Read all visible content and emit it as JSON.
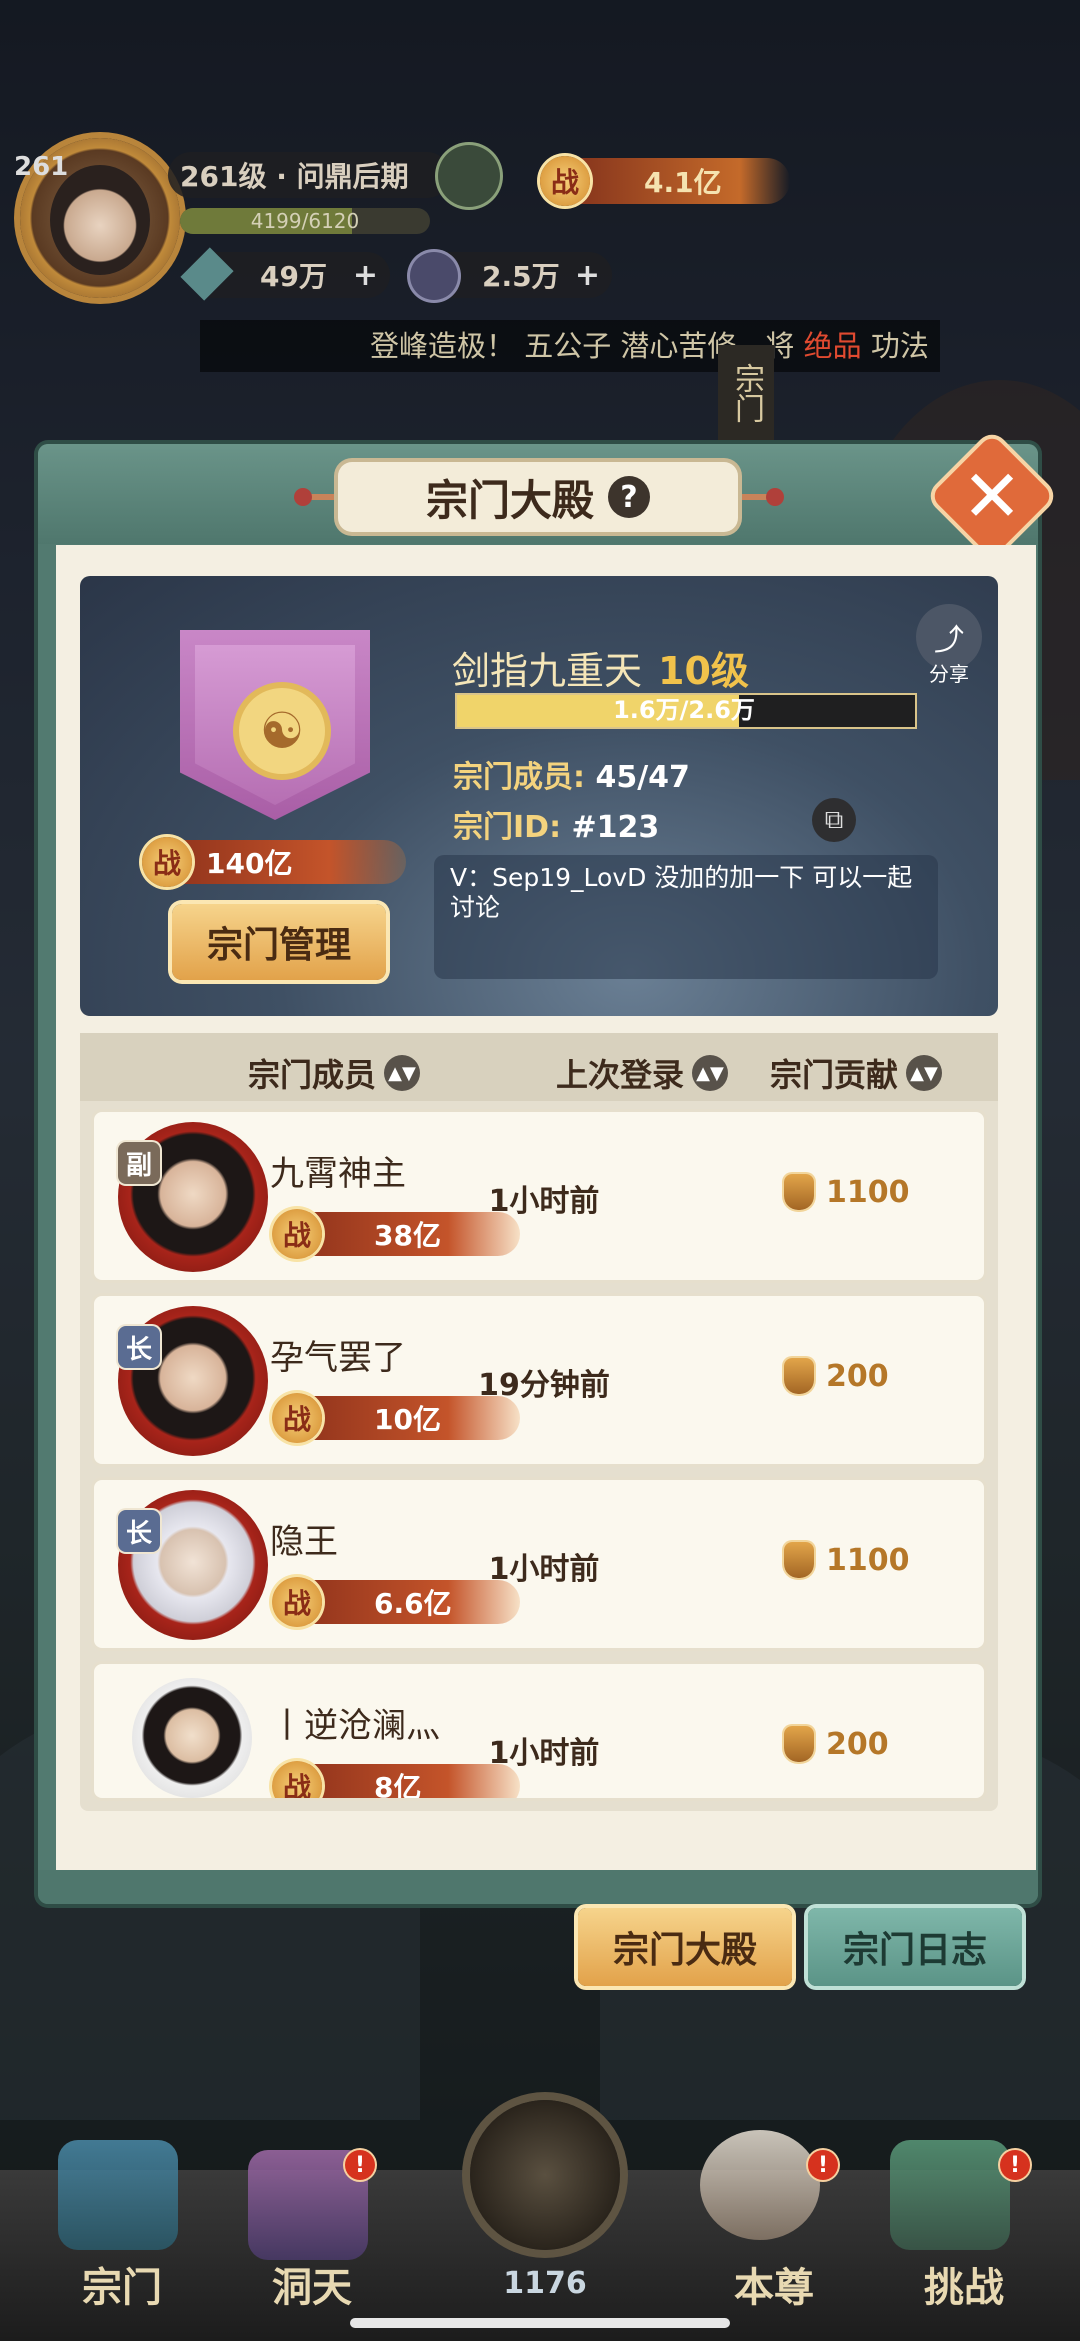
{
  "hud": {
    "player_level": "261",
    "realm": "261级 · 问鼎后期",
    "exp": "4199/6120",
    "exp_fraction": 0.686,
    "power": "4.1亿",
    "currency1": "49万",
    "currency2": "2.5万",
    "marquee_a": "登峰造极！ 五公子 潜心苦修，将 ",
    "marquee_b": "绝品",
    "marquee_c": " 功法",
    "side_sign": "宗门"
  },
  "panel": {
    "title": "宗门大殿",
    "help": "?",
    "close": "✕"
  },
  "sect": {
    "name": "剑指九重天",
    "level": "10级",
    "exp_text": "1.6万/2.6万",
    "exp_fraction": 0.615,
    "members_label": "宗门成员:",
    "members_value": "45/47",
    "id_label": "宗门ID:",
    "id_value": "#123",
    "power": "140亿",
    "power_icon": "战",
    "manage_button": "宗门管理",
    "share_label": "分享",
    "notice": "V：Sep19_LovD 没加的加一下 可以一起讨论"
  },
  "list": {
    "headers": [
      "宗门成员",
      "上次登录",
      "宗门贡献"
    ],
    "members": [
      {
        "role": "副",
        "name": "九霄神主",
        "power": "38亿",
        "login": "1小时前",
        "contrib": "1100"
      },
      {
        "role": "长",
        "name": "孕气罢了",
        "power": "10亿",
        "login": "19分钟前",
        "contrib": "200"
      },
      {
        "role": "长",
        "name": "隐王",
        "power": "6.6亿",
        "login": "1小时前",
        "contrib": "1100"
      },
      {
        "role": "",
        "name": "丨逆沧澜灬",
        "power": "8亿",
        "login": "1小时前",
        "contrib": "200"
      }
    ]
  },
  "tabs": {
    "active": "宗门大殿",
    "inactive": "宗门日志"
  },
  "nav": {
    "items": [
      "宗门",
      "洞天",
      "本尊",
      "挑战"
    ],
    "center_count": "1176",
    "badge": "!"
  },
  "colors": {
    "accent_gold": "#f1c24b",
    "panel_teal": "#527a70",
    "badge_red": "#d6321e"
  }
}
